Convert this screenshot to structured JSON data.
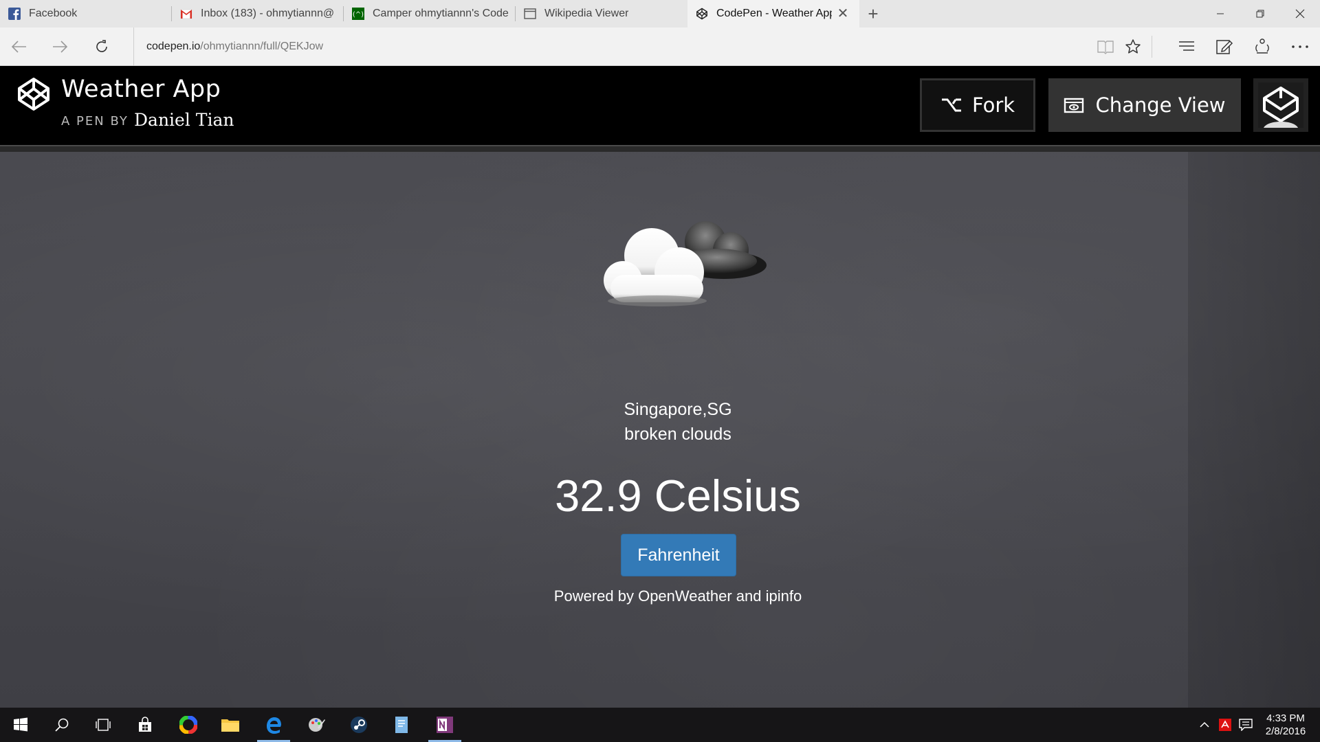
{
  "browser": {
    "tabs": [
      {
        "title": "Facebook",
        "icon": "facebook-icon",
        "active": false
      },
      {
        "title": "Inbox (183) - ohmytiannn@",
        "icon": "gmail-icon",
        "active": false
      },
      {
        "title": "Camper ohmytiannn's Code",
        "icon": "freecodecamp-icon",
        "active": false
      },
      {
        "title": "Wikipedia Viewer",
        "icon": "page-icon",
        "active": false
      },
      {
        "title": "CodePen - Weather App",
        "icon": "codepen-icon",
        "active": true
      }
    ],
    "url_host": "codepen.io",
    "url_path": "/ohmytiannn/full/QEKJow"
  },
  "codepen": {
    "title": "Weather App",
    "by_label": "A PEN BY",
    "author": "Daniel Tian",
    "fork_label": "Fork",
    "change_view_label": "Change View"
  },
  "weather": {
    "icon": "broken-clouds-icon",
    "location": "Singapore,SG",
    "description": "broken clouds",
    "temperature": "32.9 Celsius",
    "unit_button": "Fahrenheit",
    "powered_by": "Powered by OpenWeather and ipinfo"
  },
  "taskbar": {
    "time": "4:33 PM",
    "date": "2/8/2016"
  },
  "colors": {
    "button_blue": "#337ab7",
    "header_bg": "#000000",
    "board_bg": "#46464c"
  }
}
